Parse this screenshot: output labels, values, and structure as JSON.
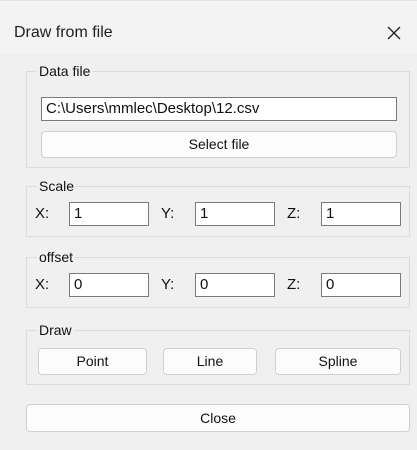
{
  "dialog": {
    "title": "Draw from file",
    "close_icon": "close-x-icon"
  },
  "data_file": {
    "legend": "Data file",
    "path_value": "C:\\Users\\mmlec\\Desktop\\12.csv",
    "select_button": "Select file"
  },
  "scale": {
    "legend": "Scale",
    "x_label": "X:",
    "x_value": "1",
    "y_label": "Y:",
    "y_value": "1",
    "z_label": "Z:",
    "z_value": "1"
  },
  "offset": {
    "legend": "offset",
    "x_label": "X:",
    "x_value": "0",
    "y_label": "Y:",
    "y_value": "0",
    "z_label": "Z:",
    "z_value": "0"
  },
  "draw": {
    "legend": "Draw",
    "point_button": "Point",
    "line_button": "Line",
    "spline_button": "Spline"
  },
  "footer": {
    "close_button": "Close"
  }
}
